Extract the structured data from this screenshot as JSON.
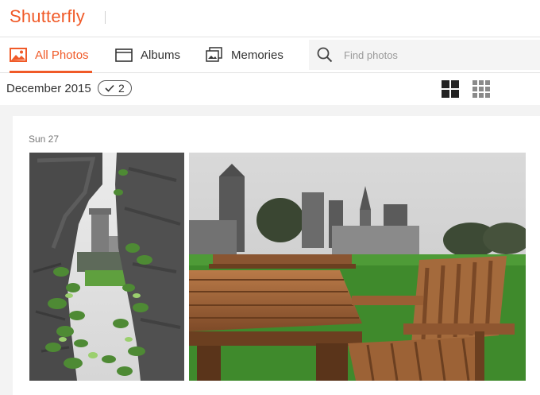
{
  "app": {
    "logo_text": "Shutterfly"
  },
  "nav": {
    "tabs": [
      {
        "label": "All Photos",
        "icon": "photo-icon",
        "active": true
      },
      {
        "label": "Albums",
        "icon": "album-icon",
        "active": false
      },
      {
        "label": "Memories",
        "icon": "memories-icon",
        "active": false
      }
    ],
    "search": {
      "placeholder": "Find photos",
      "value": ""
    }
  },
  "toolbar": {
    "month_label": "December 2015",
    "selected_count": "2",
    "views": [
      "large-grid-view-icon",
      "small-grid-view-icon"
    ]
  },
  "content": {
    "day_label": "Sun 27",
    "photos": [
      {
        "description": "castle-through-stone-wall"
      },
      {
        "description": "wooden-table-and-chairs-castle"
      }
    ]
  },
  "colors": {
    "accent": "#f05a28",
    "background": "#f3f3f3"
  }
}
